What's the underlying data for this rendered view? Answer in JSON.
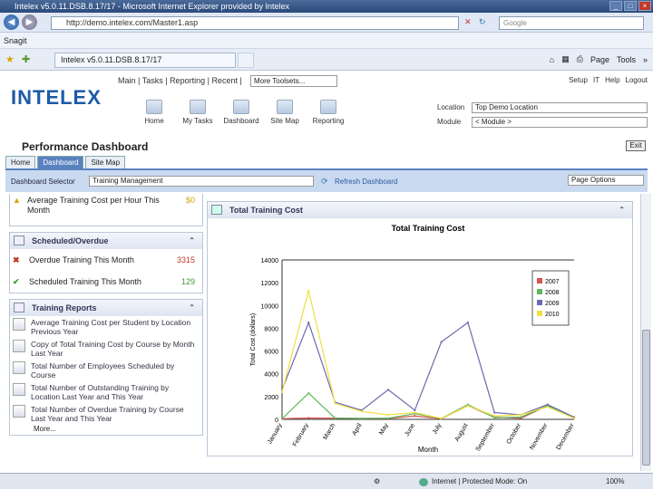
{
  "window": {
    "title": "Intelex v5.0.11.DSB.8.17/17 - Microsoft Internet Explorer provided by Intelex"
  },
  "address": {
    "url": "http://demo.intelex.com/Master1.asp",
    "search_placeholder": "Google"
  },
  "menubar": {
    "label": "Snagit"
  },
  "favorites": {
    "tab_label": "Intelex v5.0.11.DSB.8.17/17",
    "page_label": "Page",
    "tools_label": "Tools"
  },
  "app": {
    "logo": "INTELEX",
    "nav": [
      "Main",
      "Tasks",
      "Reporting",
      "Recent"
    ],
    "more_toolsets": "More Toolsets...",
    "right_links": [
      "Setup",
      "IT",
      "Help",
      "Logout"
    ],
    "icons": [
      "Home",
      "My Tasks",
      "Dashboard",
      "Site Map",
      "Reporting"
    ],
    "location_label": "Location",
    "location_value": "Top Demo Location",
    "module_label": "Module",
    "module_value": "< Module >"
  },
  "page": {
    "title": "Performance Dashboard",
    "exit": "Exit"
  },
  "tabs": [
    "Home",
    "Dashboard",
    "Site Map"
  ],
  "dashbar": {
    "selector_label": "Dashboard Selector",
    "selector_value": "Training Management",
    "refresh": "Refresh Dashboard",
    "page_options": "Page Options"
  },
  "panels": {
    "avg": {
      "label": "Average Training Cost per Hour This Month",
      "value": "$0"
    },
    "scheduled": {
      "title": "Scheduled/Overdue",
      "rows": [
        {
          "label": "Overdue Training This Month",
          "value": "3315"
        },
        {
          "label": "Scheduled Training This Month",
          "value": "129"
        }
      ]
    },
    "reports": {
      "title": "Training Reports",
      "items": [
        "Average Training Cost per Student by Location Previous Year",
        "Copy of Total Training Cost by Course by Month Last Year",
        "Total Number of Employees Scheduled by Course",
        "Total Number of Outstanding Training by Location Last Year and This Year",
        "Total Number of Overdue Training by Course Last Year and This Year"
      ],
      "more": "More..."
    }
  },
  "chart_panel": {
    "title": "Total Training Cost"
  },
  "status": {
    "text": "Internet | Protected Mode: On",
    "zoom": "100%"
  },
  "chart_data": {
    "type": "line",
    "title": "Total Training Cost",
    "xlabel": "Month",
    "ylabel": "Total Cost (dollars)",
    "ylim": [
      0,
      14000
    ],
    "yticks": [
      "0",
      "2000",
      "4000",
      "6000",
      "8000",
      "10000",
      "12000",
      "14000"
    ],
    "categories": [
      "January",
      "February",
      "March",
      "April",
      "May",
      "June",
      "July",
      "August",
      "September",
      "October",
      "November",
      "December"
    ],
    "series": [
      {
        "name": "2007",
        "color": "#d9534f",
        "values": [
          50,
          120,
          100,
          80,
          80,
          300,
          60,
          1200,
          200,
          100,
          1200,
          100
        ]
      },
      {
        "name": "2008",
        "color": "#5cb85c",
        "values": [
          50,
          2300,
          100,
          80,
          100,
          500,
          80,
          1300,
          150,
          200,
          1200,
          150
        ]
      },
      {
        "name": "2009",
        "color": "#6a6ab0",
        "values": [
          2600,
          8500,
          1500,
          800,
          2600,
          800,
          6800,
          8500,
          600,
          400,
          1300,
          200
        ]
      },
      {
        "name": "2010",
        "color": "#f0e040",
        "values": [
          2400,
          11300,
          1400,
          700,
          400,
          600,
          80,
          1200,
          300,
          400,
          1100,
          100
        ]
      }
    ]
  }
}
